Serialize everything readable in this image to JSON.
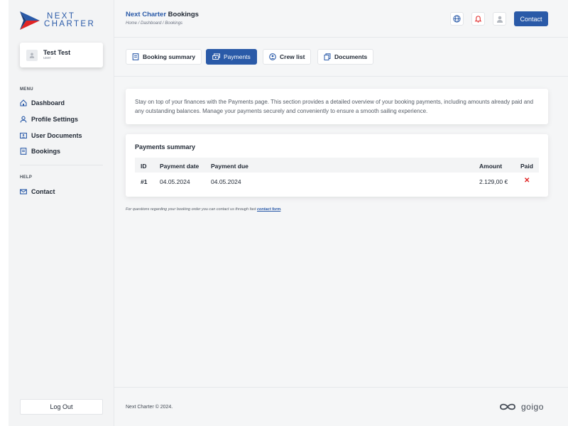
{
  "logo": {
    "line1": "NEXT",
    "line2": "CHARTER"
  },
  "user": {
    "name": "Test Test",
    "role": "user"
  },
  "sidebar": {
    "menu_label": "MENU",
    "menu_items": [
      {
        "label": "Dashboard",
        "icon": "home-icon"
      },
      {
        "label": "Profile Settings",
        "icon": "user-icon"
      },
      {
        "label": "User Documents",
        "icon": "id-card-icon"
      },
      {
        "label": "Bookings",
        "icon": "document-icon"
      }
    ],
    "help_label": "HELP",
    "help_items": [
      {
        "label": "Contact",
        "icon": "mail-icon"
      }
    ],
    "logout_label": "Log Out"
  },
  "header": {
    "title_brand": "Next Charter",
    "title_rest": " Bookings",
    "breadcrumb": "Home / Dashboard / Bookings",
    "contact_label": "Contact"
  },
  "tabs": [
    {
      "label": "Booking summary",
      "active": false
    },
    {
      "label": "Payments",
      "active": true
    },
    {
      "label": "Crew list",
      "active": false
    },
    {
      "label": "Documents",
      "active": false
    }
  ],
  "intro_text": "Stay on top of your finances with the Payments page. This section provides a detailed overview of your booking payments, including amounts already paid and any outstanding balances. Manage your payments securely and conveniently to ensure a smooth sailing experience.",
  "payments": {
    "title": "Payments summary",
    "columns": {
      "id": "ID",
      "date": "Payment date",
      "due": "Payment due",
      "amount": "Amount",
      "paid": "Paid"
    },
    "rows": [
      {
        "id": "#1",
        "date": "04.05.2024",
        "due": "04.05.2024",
        "amount": "2.129,00 €",
        "paid": "✕"
      }
    ]
  },
  "footnote": {
    "text": "For questions regarding your booking order you can contact us through fast ",
    "link": "contact form",
    "end": "."
  },
  "footer": {
    "copyright": "Next Charter © 2024.",
    "partner": "goigo"
  },
  "colors": {
    "primary": "#2a5aa8",
    "danger": "#e02424",
    "bell": "#e02424"
  }
}
